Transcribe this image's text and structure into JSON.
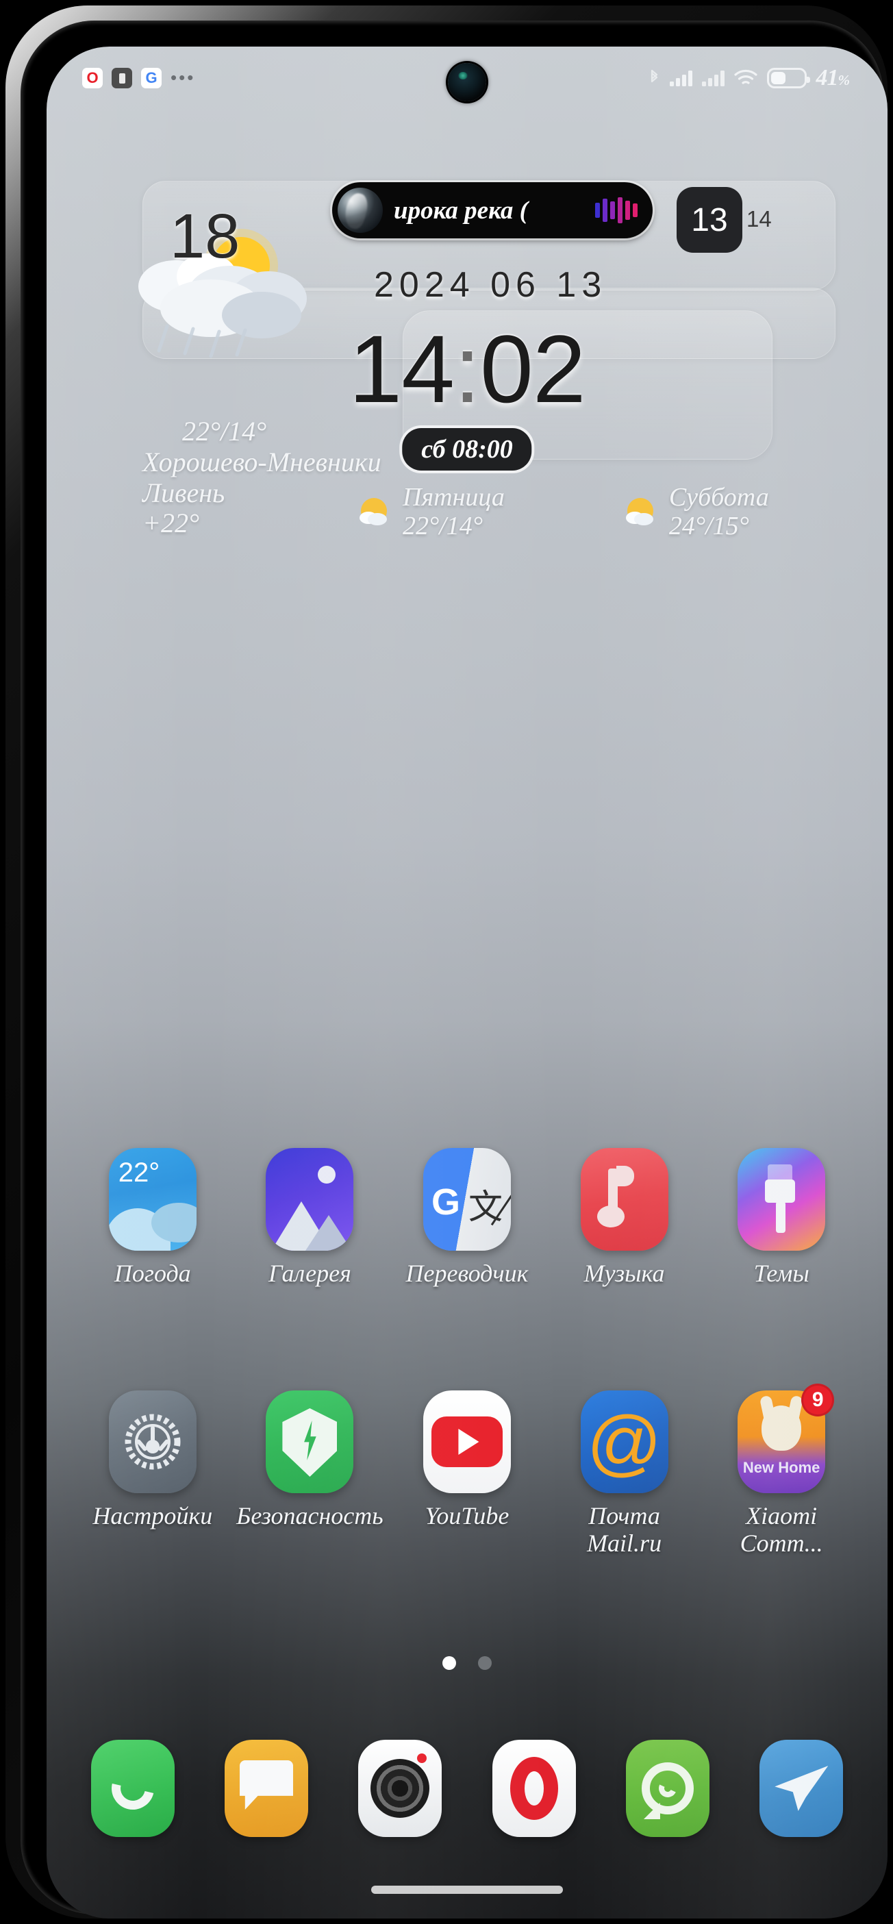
{
  "status_bar": {
    "left_icons": [
      {
        "name": "opera-notification-icon",
        "glyph": "O"
      },
      {
        "name": "app-notification-icon",
        "glyph": ""
      },
      {
        "name": "google-notification-icon",
        "glyph": "G"
      },
      {
        "name": "more-notifications-icon",
        "glyph": "•••"
      }
    ],
    "bluetooth": "bluetooth-icon",
    "signal_1": "signal-bars-icon",
    "signal_2": "signal-bars-icon",
    "wifi": "wifi-icon",
    "battery_icon": "battery-icon",
    "battery_percent": "41",
    "battery_unit": "%"
  },
  "music_pill": {
    "album_art": "album-art-thumbnail",
    "title": "ирока река (",
    "equalizer": "audio-equalizer-icon"
  },
  "weather_widget": {
    "temp_big": "18",
    "art_icon": "rain-sun-cloud-icon",
    "high_low": "22°/14°",
    "location": "Хорошево-Мневники",
    "condition": "Ливень",
    "current": "+22°",
    "forecast": [
      {
        "day": "Пятница",
        "temps": "22°/14°",
        "icon": "sun-cloud-icon"
      },
      {
        "day": "Суббота",
        "temps": "24°/15°",
        "icon": "sun-cloud-icon"
      }
    ]
  },
  "date_widget": {
    "date_line": "2024 06 13",
    "today": "13",
    "next_day": "14"
  },
  "clock_widget": {
    "hours": "14",
    "separator": ":",
    "minutes": "02",
    "alarm": "сб 08:00"
  },
  "app_rows": [
    [
      {
        "label": "Погода",
        "icon": "weather-app-icon",
        "overlay": "22°"
      },
      {
        "label": "Галерея",
        "icon": "gallery-app-icon"
      },
      {
        "label": "Переводчик",
        "icon": "google-translate-app-icon"
      },
      {
        "label": "Музыка",
        "icon": "music-app-icon"
      },
      {
        "label": "Темы",
        "icon": "themes-app-icon"
      }
    ],
    [
      {
        "label": "Настройки",
        "icon": "settings-app-icon"
      },
      {
        "label": "Безопасность",
        "icon": "security-app-icon"
      },
      {
        "label": "YouTube",
        "icon": "youtube-app-icon"
      },
      {
        "label": "Почта Mail.ru",
        "icon": "mail-ru-app-icon"
      },
      {
        "label": "Xiaomi Comm...",
        "icon": "xiaomi-community-app-icon",
        "badge": "9",
        "overlay": "New Home"
      }
    ]
  ],
  "page_dots": {
    "total": 2,
    "active_index": 0
  },
  "dock": [
    {
      "name": "phone-dock-icon"
    },
    {
      "name": "messages-dock-icon"
    },
    {
      "name": "camera-dock-icon"
    },
    {
      "name": "opera-dock-icon"
    },
    {
      "name": "whatsapp-dock-icon"
    },
    {
      "name": "telegram-dock-icon"
    }
  ],
  "home_indicator": "home-gesture-bar",
  "colors": {
    "accent_red": "#e8202a",
    "badge_red": "#e8202a",
    "green": "#31b758",
    "blue": "#4285f4"
  }
}
